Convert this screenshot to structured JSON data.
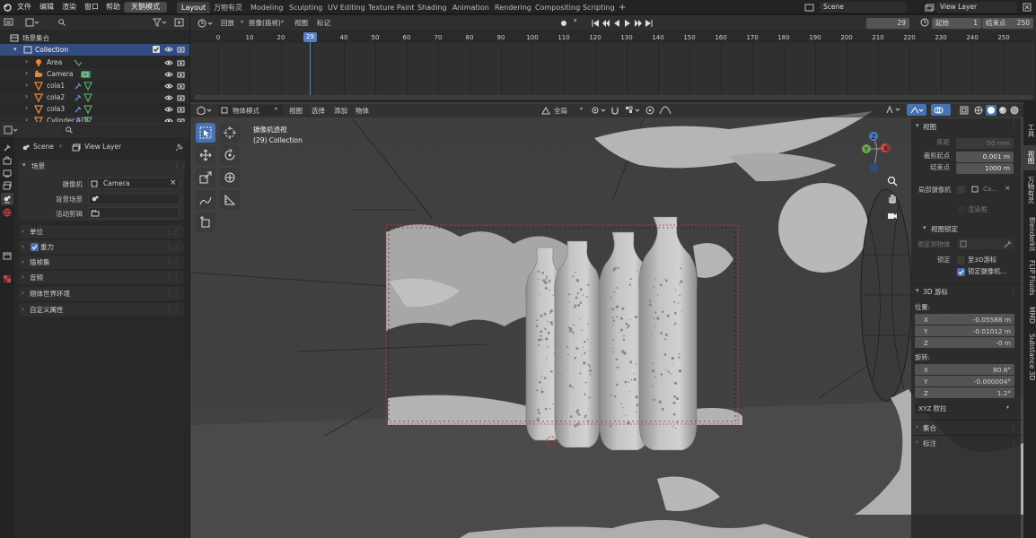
{
  "topbar": {
    "menus": [
      "文件",
      "编辑",
      "渲染",
      "窗口",
      "帮助"
    ],
    "mode_pill": "天鹅模式",
    "workspaces": [
      "Layout",
      "万物有灵",
      "Modeling",
      "Sculpting",
      "UV Editing",
      "Texture Paint",
      "Shading",
      "Animation",
      "Rendering",
      "Compositing",
      "Scripting"
    ],
    "active_workspace": "Layout",
    "add_tab": "+",
    "scene_name": "Scene",
    "view_layer": "View Layer"
  },
  "outliner": {
    "search_placeholder": "",
    "root": "场景集合",
    "collection": "Collection",
    "items": [
      "Area",
      "Camera",
      "cola1",
      "cola2",
      "cola3",
      "Cylinder.018"
    ]
  },
  "timeline": {
    "menus": [
      "回放",
      "抠像(插帧)",
      "视图",
      "标记"
    ],
    "current_frame": "29",
    "start_label": "起始",
    "start": "1",
    "end_label": "结束点",
    "end": "250",
    "ticks": [
      "0",
      "10",
      "20",
      "29",
      "40",
      "50",
      "60",
      "70",
      "80",
      "90",
      "100",
      "110",
      "120",
      "130",
      "140",
      "150",
      "160",
      "170",
      "180",
      "190",
      "200",
      "210",
      "220",
      "230",
      "240",
      "250"
    ]
  },
  "properties": {
    "search_placeholder": "",
    "breadcrumb_scene": "Scene",
    "breadcrumb_layer": "View Layer",
    "scene_section": "场景",
    "camera_label": "摄像机",
    "camera_value": "Camera",
    "bg_scene_label": "背景场景",
    "active_clip_label": "活动剪辑",
    "sections": [
      "单位",
      "重力",
      "插帧集",
      "音频",
      "刚体世界环境",
      "自定义属性"
    ]
  },
  "viewport": {
    "mode": "物体模式",
    "menus": [
      "视图",
      "选择",
      "添加",
      "物体"
    ],
    "transform_orient": "全局",
    "overlay_title": "摄像机透视",
    "overlay_collection": "(29) Collection"
  },
  "npanel": {
    "view_section": "视图",
    "focal_label": "焦距",
    "focal_value": "50 mm",
    "clip_start_label": "裁剪起点",
    "clip_start_value": "0.001 m",
    "clip_end_label": "结束点",
    "clip_end_value": "1000 m",
    "local_camera_label": "局部摄像机",
    "local_camera_value": "Ca...",
    "render_region": "渲染框",
    "view_lock_section": "视图锁定",
    "lock_to_object_label": "锁定到物体",
    "lock_label": "锁定",
    "lock_3d_cursor": "至3D游标",
    "lock_camera": "锁定摄像机...",
    "cursor_section": "3D 游标",
    "location_label": "位置:",
    "loc_x": "-0.05588 m",
    "loc_y": "-0.01012 m",
    "loc_z": "-0 m",
    "rotation_label": "旋转:",
    "rot_x": "80.8°",
    "rot_y": "-0.000004°",
    "rot_z": "1.2°",
    "rot_mode": "XYZ 欧拉",
    "collection_section": "集合",
    "annotation_section": "标注",
    "axis_x": "X",
    "axis_y": "Y",
    "axis_z": "Z"
  },
  "side_tabs": [
    "工具",
    "视图",
    "万物有灵",
    "Blenderkit",
    "FLIP Fluids",
    "MMD",
    "Substance 3D"
  ],
  "colors": {
    "accent": "#4772b3",
    "orange": "#e5863a",
    "playhead": "#5680c2",
    "active_tab": "#3d3d3d"
  }
}
